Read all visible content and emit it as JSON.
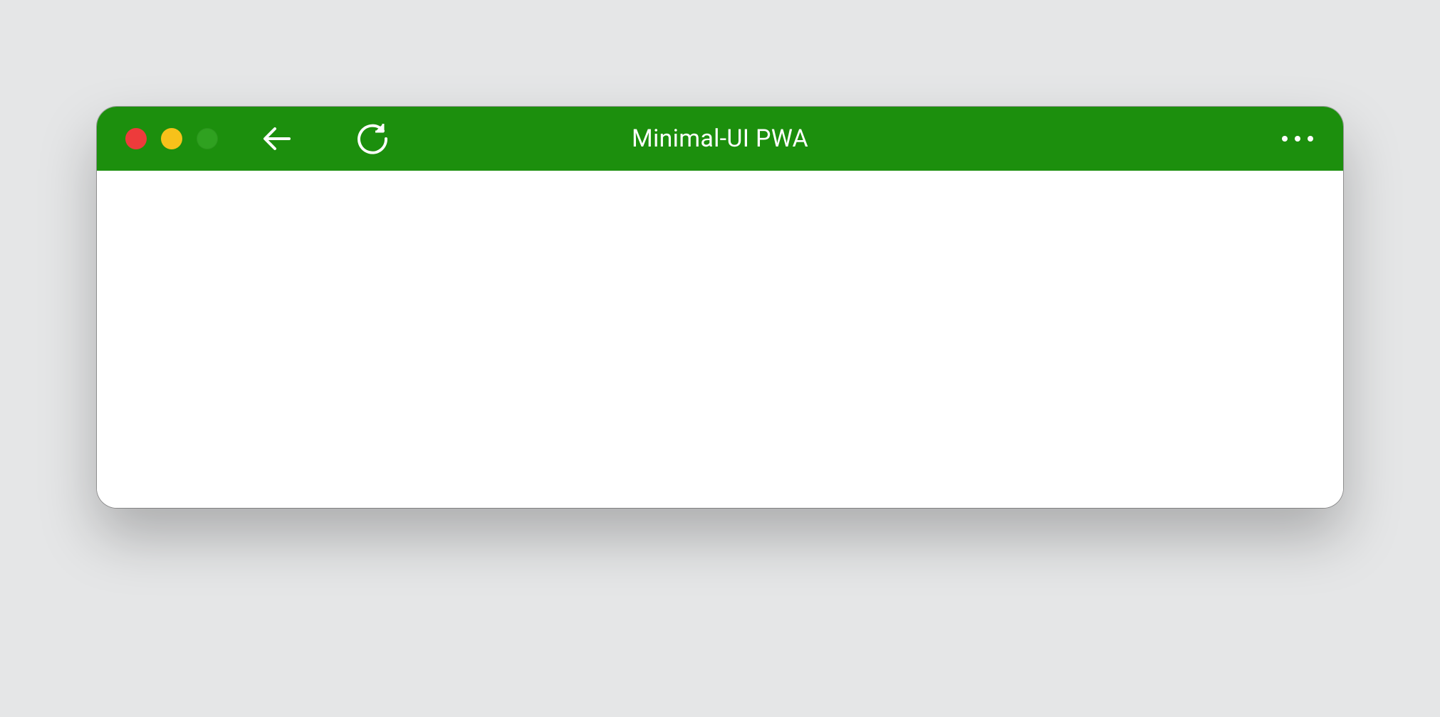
{
  "window": {
    "title": "Minimal-UI PWA",
    "colors": {
      "titlebar": "#1c8f0d",
      "close": "#ed3b3b",
      "minimize": "#f7c11a",
      "maximize": "#2fa120"
    },
    "icons": {
      "back": "arrow-left-icon",
      "reload": "reload-icon",
      "more": "more-options-icon"
    }
  }
}
